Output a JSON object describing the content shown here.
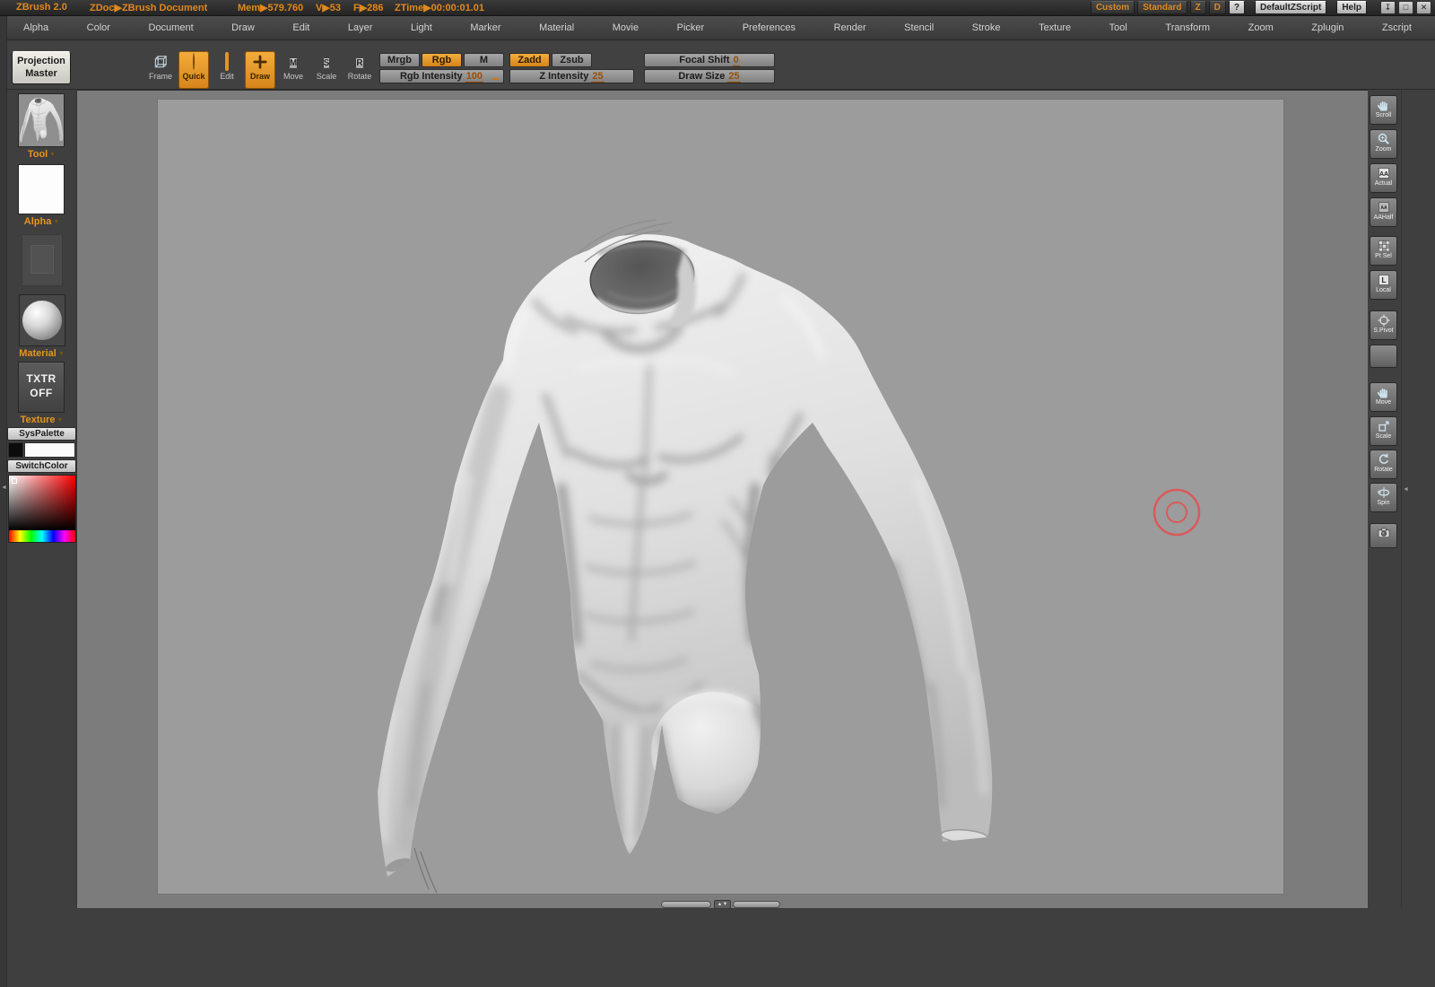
{
  "titlebar": {
    "app_name": "ZBrush 2.0",
    "document_label": "ZDoc▶ZBrush Document",
    "mem": "Mem▶579.760",
    "verts": "V▶53",
    "faces": "F▶286",
    "ztime": "ZTime▶00:00:01.01",
    "custom": "Custom",
    "standard": "Standard",
    "z_toggle": "Z",
    "d_toggle": "D",
    "quick_help": "?",
    "default_zscript": "DefaultZScript",
    "help": "Help"
  },
  "icons": {
    "caret_down": "▼",
    "win_shade": "↧",
    "win_max": "□",
    "win_close": "✕",
    "arrow_up": "▲",
    "arrow_down": "▼",
    "collapse_left": "◄",
    "aa": "AA",
    "local_letter": "L"
  },
  "menubar": {
    "items": [
      "Alpha",
      "Color",
      "Document",
      "Draw",
      "Edit",
      "Layer",
      "Light",
      "Marker",
      "Material",
      "Movie",
      "Picker",
      "Preferences",
      "Render",
      "Stencil",
      "Stroke",
      "Texture",
      "Tool",
      "Transform",
      "Zoom",
      "Zplugin",
      "Zscript"
    ]
  },
  "toolbar": {
    "projection_master": "Projection Master",
    "tools": [
      {
        "label": "Frame"
      },
      {
        "label": "Quick"
      },
      {
        "label": "Edit"
      },
      {
        "label": "Draw"
      },
      {
        "label": "Move"
      },
      {
        "label": "Scale"
      },
      {
        "label": "Rotate"
      }
    ],
    "move_letter": "M",
    "scale_letter": "S",
    "rotate_letter": "R",
    "color_modes": [
      {
        "label": "Mrgb"
      },
      {
        "label": "Rgb"
      },
      {
        "label": "M"
      }
    ],
    "sculpt_modes": [
      {
        "label": "Zadd"
      },
      {
        "label": "Zsub"
      }
    ],
    "sliders": {
      "focal_shift": {
        "label": "Focal Shift",
        "value": "0"
      },
      "rgb_intensity": {
        "label": "Rgb Intensity",
        "value": "100"
      },
      "z_intensity": {
        "label": "Z Intensity",
        "value": "25"
      },
      "draw_size": {
        "label": "Draw Size",
        "value": "25"
      }
    }
  },
  "left_panel": {
    "tool_label": "Tool",
    "alpha_label": "Alpha",
    "material_label": "Material",
    "texture_label": "Texture",
    "txtr_button": "TXTR OFF",
    "syspalette": "SysPalette",
    "switchcolor": "SwitchColor"
  },
  "right_toolbar": {
    "items": [
      {
        "label": "Scroll"
      },
      {
        "label": "Zoom"
      },
      {
        "label": "Actual"
      },
      {
        "label": "AAHalf"
      },
      {
        "label": "Pt Sel"
      },
      {
        "label": "Local"
      },
      {
        "label": "S.Pivot"
      },
      {
        "label": ""
      },
      {
        "label": "Move"
      },
      {
        "label": "Scale"
      },
      {
        "label": "Rotate"
      },
      {
        "label": "Spin"
      },
      {
        "label": ""
      }
    ]
  },
  "colors": {
    "accent_orange": "#e0891e",
    "active_button": "#e89a2c",
    "canvas_bg": "#7c7c7c",
    "document_bg": "#9c9c9c",
    "cursor_red": "#e05252"
  }
}
